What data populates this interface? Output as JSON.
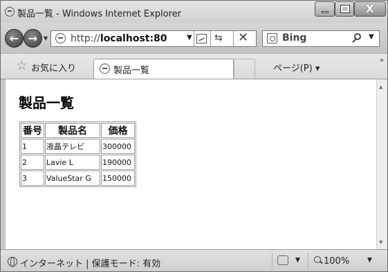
{
  "window": {
    "title": "製品一覧 - Windows Internet Explorer",
    "close_glyph": "X"
  },
  "address": {
    "url_prefix": "http://",
    "url_host": "localhost:80"
  },
  "search": {
    "provider": "Bing"
  },
  "favorites": {
    "label": "お気に入り"
  },
  "tab": {
    "label": "製品一覧"
  },
  "command_bar": {
    "page_menu": "ページ(P)"
  },
  "page": {
    "heading": "製品一覧",
    "table": {
      "headers": [
        "番号",
        "製品名",
        "価格"
      ],
      "rows": [
        [
          "1",
          "液晶テレビ",
          "300000"
        ],
        [
          "2",
          "Lavie L",
          "190000"
        ],
        [
          "3",
          "ValueStar G",
          "150000"
        ]
      ]
    }
  },
  "status": {
    "zone_text": "インターネット | 保護モード: 有効",
    "zoom": "100%"
  }
}
